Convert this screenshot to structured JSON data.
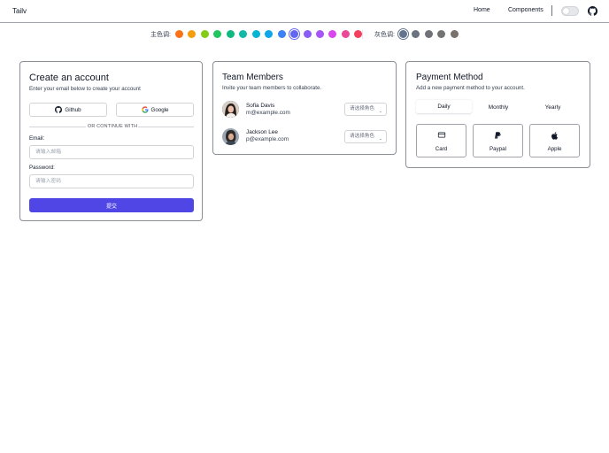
{
  "header": {
    "brand": "Tailv",
    "nav": {
      "home": "Home",
      "components": "Components"
    },
    "theme_toggle_on": false,
    "github_icon": "github-icon"
  },
  "colors": {
    "primary_label": "主色调:",
    "primary_swatches": [
      "#f97316",
      "#f59e0b",
      "#84cc16",
      "#22c55e",
      "#10b981",
      "#14b8a6",
      "#06b6d4",
      "#0ea5e9",
      "#3b82f6",
      "#6366f1",
      "#8b5cf6",
      "#a855f7",
      "#d946ef",
      "#ec4899",
      "#f43f5e"
    ],
    "primary_selected": "#6366f1",
    "gray_label": "灰色调:",
    "gray_swatches": [
      "#64748b",
      "#6b7280",
      "#71717a",
      "#737373",
      "#78716c"
    ],
    "gray_selected": "#64748b"
  },
  "create_account": {
    "title": "Create an account",
    "subtitle": "Enter your email below to create your account",
    "github_label": "Github",
    "google_label": "Google",
    "divider_text": "OR CONTINUE WITH",
    "email_label": "Email:",
    "email_placeholder": "请输入邮箱",
    "password_label": "Password:",
    "password_placeholder": "请输入密码",
    "submit_label": "提交",
    "submit_color": "#4f46e5"
  },
  "team": {
    "title": "Team Members",
    "subtitle": "Invite your team members to collaborate.",
    "members": [
      {
        "name": "Sofia Davis",
        "email": "m@example.com",
        "role_placeholder": "请选择角色"
      },
      {
        "name": "Jackson Lee",
        "email": "p@example.com",
        "role_placeholder": "请选择角色"
      }
    ]
  },
  "payment": {
    "title": "Payment Method",
    "subtitle": "Add a new payment method to your account.",
    "tabs": [
      "Daily",
      "Monthly",
      "Yearly"
    ],
    "active_tab": "Daily",
    "options": [
      {
        "label": "Card",
        "icon": "credit-card-icon"
      },
      {
        "label": "Paypal",
        "icon": "paypal-icon"
      },
      {
        "label": "Apple",
        "icon": "apple-icon"
      }
    ]
  }
}
